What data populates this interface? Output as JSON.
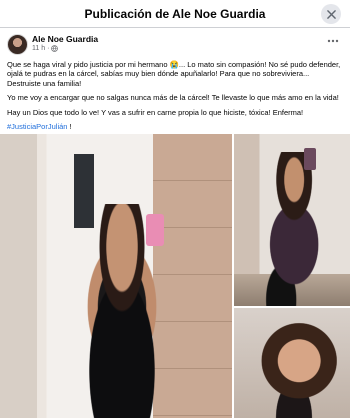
{
  "modal": {
    "title": "Publicación de Ale Noe Guardia",
    "close_icon": "close-icon"
  },
  "post": {
    "author": "Ale Noe Guardia",
    "time": "11 h",
    "separator": "·",
    "privacy_icon": "globe-icon",
    "more_icon": "more-horizontal-icon",
    "paragraphs": [
      "Que se haga viral y pido justicia por mi hermano 😭... Lo mato sin compasión! No sé pudo defender, ojalá te pudras en la cárcel, sabías muy bien dónde apuñalarlo! Para que no sobreviviera... Destruiste una familia!",
      "Yo me voy a encargar que no salgas nunca más de la cárcel! Te llevaste lo que más amo en la vida!",
      "Hay un Dios que todo lo ve! Y vas a sufrir en carne propia lo que hiciste, tóxica! Enferma!"
    ],
    "hashtag": "#JusticiaPorJulián",
    "hashtag_suffix": " !"
  },
  "photos": [
    {
      "description": "photo-main"
    },
    {
      "description": "photo-top-right"
    },
    {
      "description": "photo-bottom-right"
    }
  ],
  "colors": {
    "link": "#216fdb",
    "secondary_text": "#65676b",
    "divider": "#ced0d4"
  }
}
